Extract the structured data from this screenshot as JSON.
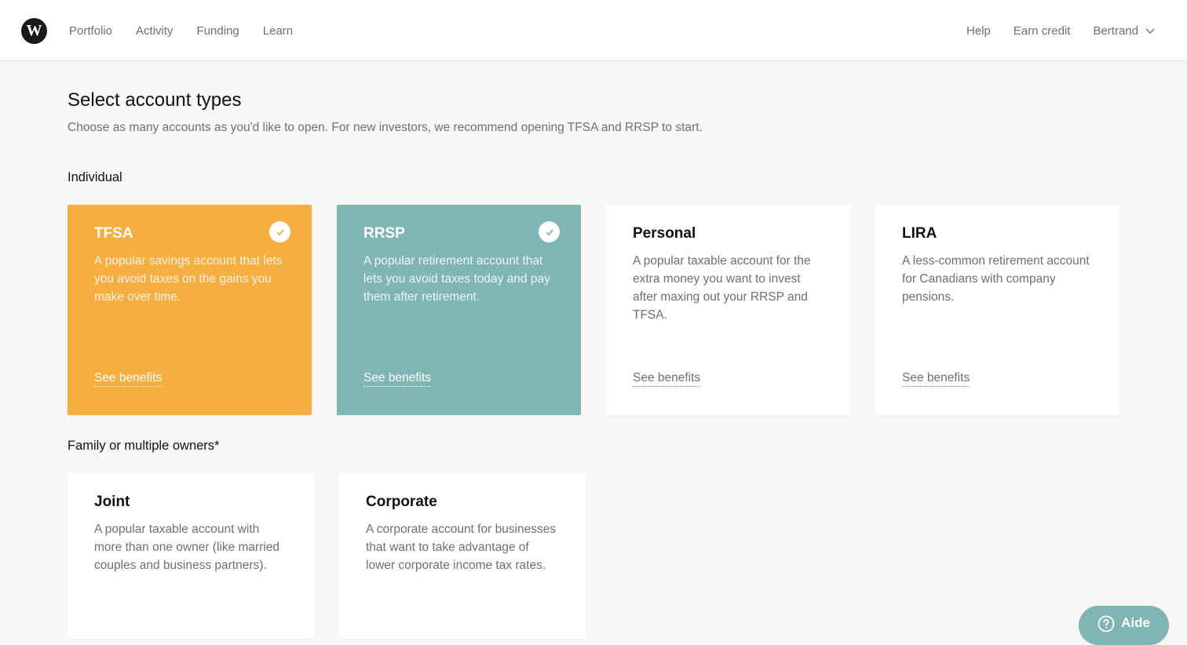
{
  "nav": {
    "logo_letter": "W",
    "left": [
      "Portfolio",
      "Activity",
      "Funding",
      "Learn"
    ],
    "help": "Help",
    "earn_credit": "Earn credit",
    "user": "Bertrand"
  },
  "page": {
    "title": "Select account types",
    "subtitle": "Choose as many accounts as you'd like to open. For new investors, we recommend opening TFSA and RRSP to start."
  },
  "sections": {
    "individual": "Individual",
    "family": "Family or multiple owners*"
  },
  "cards": {
    "tfsa": {
      "title": "TFSA",
      "desc": "A popular savings account that lets you avoid taxes on the gains you make over time.",
      "link": "See benefits",
      "selected": true
    },
    "rrsp": {
      "title": "RRSP",
      "desc": "A popular retirement account that lets you avoid taxes today and pay them after retirement.",
      "link": "See benefits",
      "selected": true
    },
    "personal": {
      "title": "Personal",
      "desc": "A popular taxable account for the extra money you want to invest after maxing out your RRSP and TFSA.",
      "link": "See benefits",
      "selected": false
    },
    "lira": {
      "title": "LIRA",
      "desc": "A less-common retirement account for Canadians with company pensions.",
      "link": "See benefits",
      "selected": false
    },
    "joint": {
      "title": "Joint",
      "desc": "A popular taxable account with more than one owner (like married couples and business partners).",
      "selected": false
    },
    "corporate": {
      "title": "Corporate",
      "desc": "A corporate account for businesses that want to take advantage of lower corporate income tax rates.",
      "selected": false
    }
  },
  "help_widget": {
    "label": "Aide",
    "icon": "question-circle-icon"
  },
  "colors": {
    "tfsa": "#f6ae40",
    "rrsp": "#7fb5b2",
    "background": "#f8f7f6"
  }
}
